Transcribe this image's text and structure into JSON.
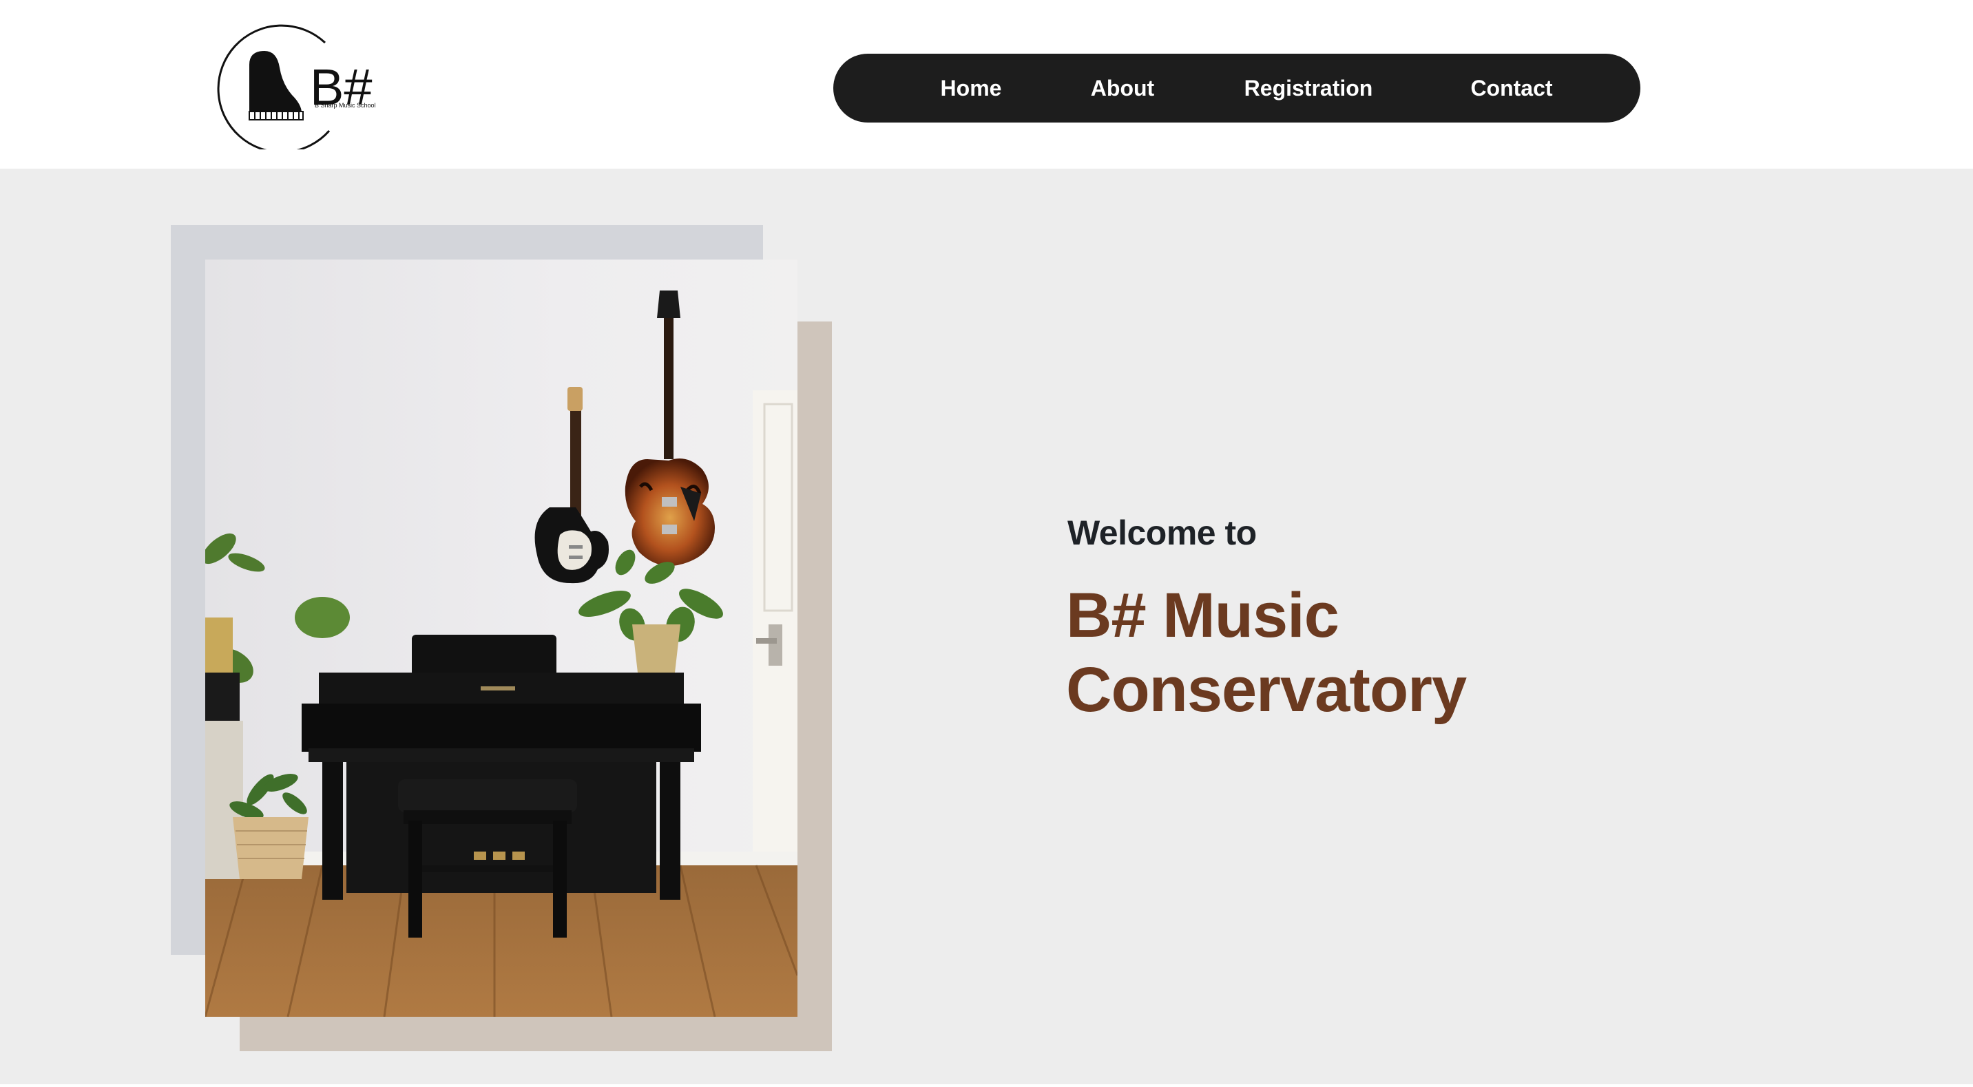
{
  "brand": {
    "logo_text": "B#",
    "logo_subtext": "B Sharp Music School",
    "logo_icon": "grand-piano-icon"
  },
  "nav": {
    "items": [
      {
        "label": "Home"
      },
      {
        "label": "About"
      },
      {
        "label": "Registration"
      },
      {
        "label": "Contact"
      }
    ]
  },
  "hero": {
    "welcome": "Welcome to",
    "title_line1": "B# Music",
    "title_line2": "Conservatory",
    "image_subject": "piano-room-with-guitars-photo"
  },
  "colors": {
    "nav_bg": "#1d1d1d",
    "hero_bg": "#ededed",
    "title": "#6b3a20",
    "welcome": "#1e2227",
    "frame_back": "#d3d5da",
    "frame_front": "#cfc5bb"
  }
}
